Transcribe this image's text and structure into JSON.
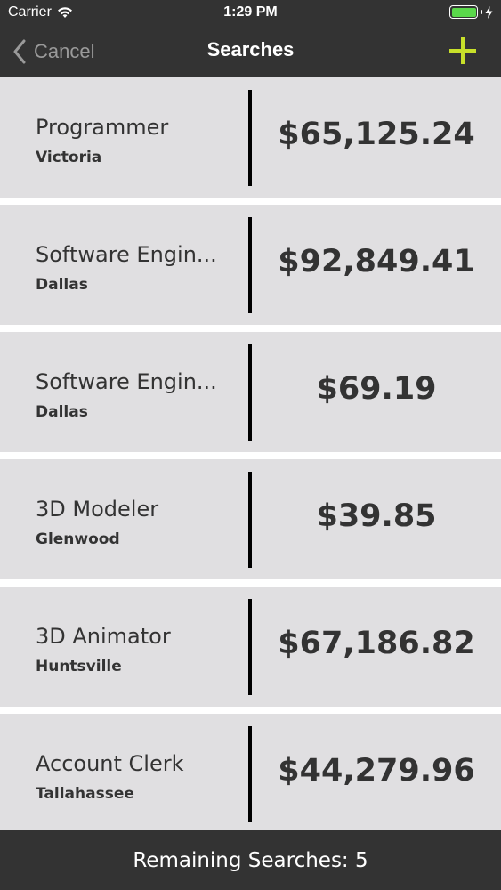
{
  "status_bar": {
    "carrier": "Carrier",
    "time": "1:29 PM",
    "battery_level": 1.0,
    "battery_color": "#5ad84b",
    "icons": [
      "wifi-icon",
      "battery-icon",
      "bolt-icon"
    ]
  },
  "nav": {
    "cancel_label": "Cancel",
    "title": "Searches",
    "add_icon": "plus-icon",
    "accent_color": "#c8e02a"
  },
  "searches": [
    {
      "title": "Programmer",
      "location": "Victoria",
      "amount": "$65,125.24"
    },
    {
      "title": "Software Engin...",
      "location": "Dallas",
      "amount": "$92,849.41"
    },
    {
      "title": "Software Engin...",
      "location": "Dallas",
      "amount": "$69.19"
    },
    {
      "title": "3D Modeler",
      "location": "Glenwood",
      "amount": "$39.85"
    },
    {
      "title": "3D Animator",
      "location": "Huntsville",
      "amount": "$67,186.82"
    },
    {
      "title": "Account Clerk",
      "location": "Tallahassee",
      "amount": "$44,279.96"
    }
  ],
  "footer": {
    "label": "Remaining Searches: 5"
  },
  "colors": {
    "bar_background": "#333333",
    "row_background": "#e0dfe1",
    "text": "#333333"
  }
}
